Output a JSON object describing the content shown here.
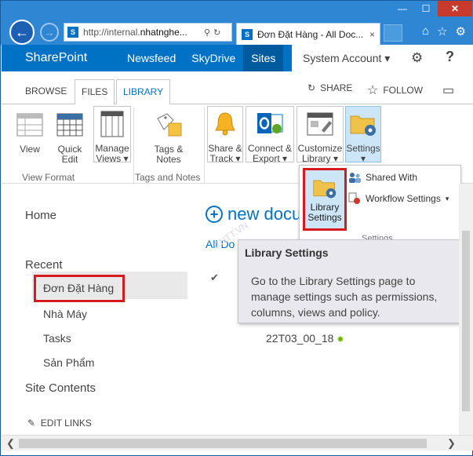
{
  "browser": {
    "url_prefix": "http://internal.",
    "url_host": "nhatnghe...",
    "tab_title": "Đơn Đặt Hàng - All Doc...",
    "tab_close": "×",
    "back": "←",
    "forward": "→",
    "min": "—",
    "max": "☐",
    "close": "✕",
    "home": "⌂",
    "star": "☆",
    "gear": "⚙",
    "search": "⚲",
    "refresh": "↻",
    "site_icon": "S"
  },
  "suite_bar": {
    "brand": "SharePoint",
    "links": [
      "Newsfeed",
      "SkyDrive",
      "Sites"
    ],
    "account": "System Account ▾",
    "gear": "⚙",
    "help": "?"
  },
  "ribbon_tabs": {
    "browse": "BROWSE",
    "files": "FILES",
    "library": "LIBRARY",
    "share": "SHARE",
    "follow": "FOLLOW",
    "focus": "▭"
  },
  "ribbon": {
    "view": "View",
    "quick_edit": "Quick Edit",
    "manage_views": "Manage Views ▾",
    "tags_notes": "Tags & Notes",
    "share_track": "Share & Track ▾",
    "connect_export": "Connect & Export ▾",
    "customize_library": "Customize Library ▾",
    "settings": "Settings",
    "settings_arrow": "▾",
    "group_view_format": "View Format",
    "group_tags_notes": "Tags and Notes"
  },
  "settings_menu": {
    "library_settings": "Library Settings",
    "shared_with": "Shared With",
    "workflow_settings": "Workflow Settings",
    "workflow_arrow": "▾",
    "group_label": "Settings"
  },
  "tooltip": {
    "title": "Library Settings",
    "body": "Go to the Library Settings page to manage settings such as permissions, columns, views and policy."
  },
  "quick_launch": {
    "home": "Home",
    "recent": "Recent",
    "items": [
      "Đơn Đặt Hàng",
      "Nhà Máy",
      "Tasks",
      "Sản Phẩm"
    ],
    "site_contents": "Site Contents",
    "edit_links": "EDIT LINKS",
    "edit_icon": "✎"
  },
  "main": {
    "new_document": "new docu",
    "plus": "+",
    "all_documents": "All Do",
    "check": "✔",
    "file_name": "22T03_00_18",
    "new_icon": "✸"
  },
  "scrollbar": {
    "left": "❮",
    "right": "❯"
  }
}
